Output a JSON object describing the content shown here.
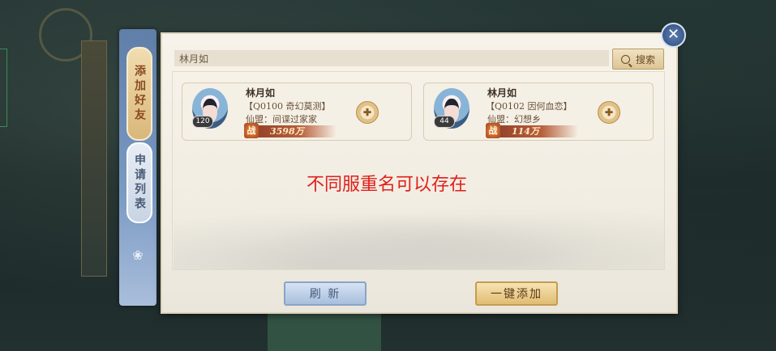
{
  "side_tabs": [
    {
      "label": "添加好友",
      "active": true
    },
    {
      "label": "申请列表",
      "active": false
    }
  ],
  "search": {
    "value": "林月如",
    "button_label": "搜索",
    "icon": "search-icon"
  },
  "results": [
    {
      "name": "林月如",
      "server": "【Q0100 奇幻莫测】",
      "guild": "仙盟：间谍过家家",
      "level": "120",
      "power_icon": "战",
      "power": "3598万"
    },
    {
      "name": "林月如",
      "server": "【Q0102 因何血恋】",
      "guild": "仙盟：幻想乡",
      "level": "44",
      "power_icon": "战",
      "power": "114万"
    }
  ],
  "note": "不同服重名可以存在",
  "buttons": {
    "refresh": "刷 新",
    "add_all": "一键添加"
  },
  "colors": {
    "note_red": "#e0201b",
    "panel_bg": "#f4f0e6",
    "tab_gold": "#d9b77a",
    "tab_blue": "#7b9bc4"
  }
}
